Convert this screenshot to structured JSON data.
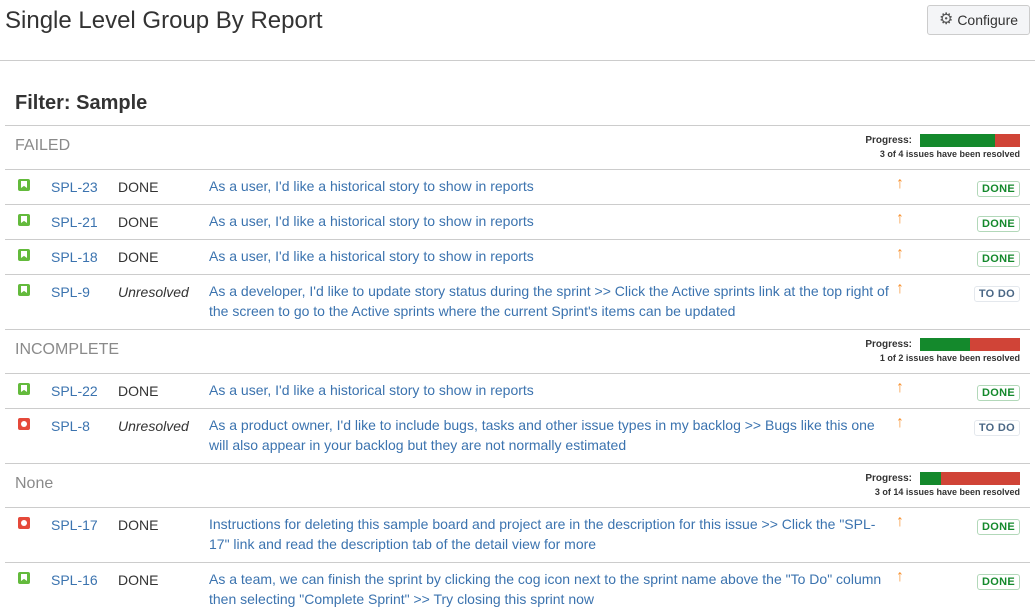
{
  "header": {
    "title": "Single Level Group By Report",
    "configure_label": "Configure",
    "configure_icon": "gear-icon"
  },
  "filter": {
    "title": "Filter: Sample"
  },
  "colors": {
    "done_bar": "#14892c",
    "todo_bar": "#d04437",
    "link": "#3b73af",
    "priority": "#f79232"
  },
  "groups": [
    {
      "name": "FAILED",
      "progress_label": "Progress:",
      "resolved": 3,
      "total": 4,
      "summary": "3 of 4 issues have been resolved",
      "issues": [
        {
          "type": "story",
          "key": "SPL-23",
          "resolution": "DONE",
          "summary": "As a user, I'd like a historical story to show in reports",
          "priority": "↑",
          "status": "DONE"
        },
        {
          "type": "story",
          "key": "SPL-21",
          "resolution": "DONE",
          "summary": "As a user, I'd like a historical story to show in reports",
          "priority": "↑",
          "status": "DONE"
        },
        {
          "type": "story",
          "key": "SPL-18",
          "resolution": "DONE",
          "summary": "As a user, I'd like a historical story to show in reports",
          "priority": "↑",
          "status": "DONE"
        },
        {
          "type": "story",
          "key": "SPL-9",
          "resolution": "Unresolved",
          "summary": "As a developer, I'd like to update story status during the sprint >> Click the Active sprints link at the top right of the screen to go to the Active sprints where the current Sprint's items can be updated",
          "priority": "↑",
          "status": "TO DO"
        }
      ]
    },
    {
      "name": "INCOMPLETE",
      "progress_label": "Progress:",
      "resolved": 1,
      "total": 2,
      "summary": "1 of 2 issues have been resolved",
      "issues": [
        {
          "type": "story",
          "key": "SPL-22",
          "resolution": "DONE",
          "summary": "As a user, I'd like a historical story to show in reports",
          "priority": "↑",
          "status": "DONE"
        },
        {
          "type": "bug",
          "key": "SPL-8",
          "resolution": "Unresolved",
          "summary": "As a product owner, I'd like to include bugs, tasks and other issue types in my backlog >> Bugs like this one will also appear in your backlog but they are not normally estimated",
          "priority": "↑",
          "status": "TO DO"
        }
      ]
    },
    {
      "name": "None",
      "progress_label": "Progress:",
      "resolved": 3,
      "total": 14,
      "summary": "3 of 14 issues have been resolved",
      "issues": [
        {
          "type": "bug",
          "key": "SPL-17",
          "resolution": "DONE",
          "summary": "Instructions for deleting this sample board and project are in the description for this issue >> Click the \"SPL-17\" link and read the description tab of the detail view for more",
          "priority": "↑",
          "status": "DONE"
        },
        {
          "type": "story",
          "key": "SPL-16",
          "resolution": "DONE",
          "summary": "As a team, we can finish the sprint by clicking the cog icon next to the sprint name above the \"To Do\" column then selecting \"Complete Sprint\" >> Try closing this sprint now",
          "priority": "↑",
          "status": "DONE"
        }
      ]
    }
  ]
}
